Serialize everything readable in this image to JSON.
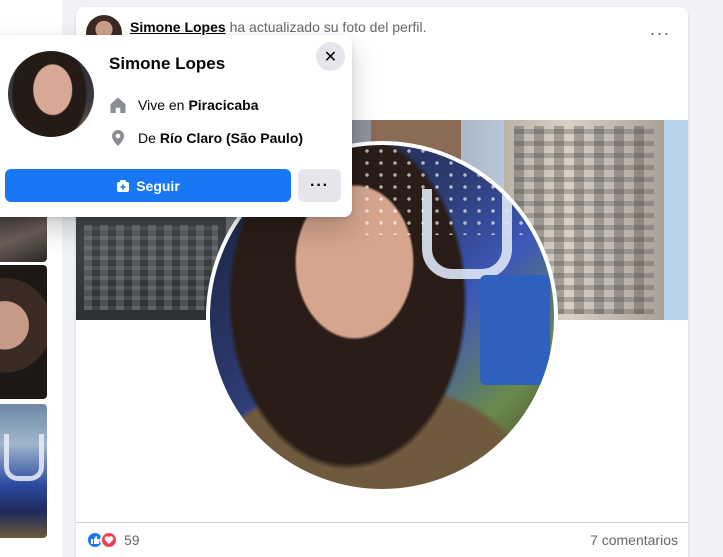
{
  "post": {
    "author_name": "Simone Lopes",
    "action_text": "ha actualizado su foto del perfil.",
    "more_options": "···",
    "reaction_count": "59",
    "comments_text": "7 comentarios",
    "reaction_icons": [
      "like-icon",
      "love-icon"
    ]
  },
  "hovercard": {
    "name": "Simone Lopes",
    "lives_prefix": "Vive en",
    "lives_place": "Piracicaba",
    "from_prefix": "De",
    "from_place": "Río Claro (São Paulo)",
    "close_glyph": "✕",
    "follow_label": "Seguir",
    "more_glyph": "···",
    "icons": {
      "lives": "home-icon",
      "from": "location-pin-icon",
      "follow": "follow-icon"
    }
  },
  "colors": {
    "brand_blue": "#1877f2",
    "love_red": "#f33e58",
    "secondary_text": "#65676b",
    "button_gray": "#e4e6eb",
    "page_bg": "#f0f2f5"
  }
}
